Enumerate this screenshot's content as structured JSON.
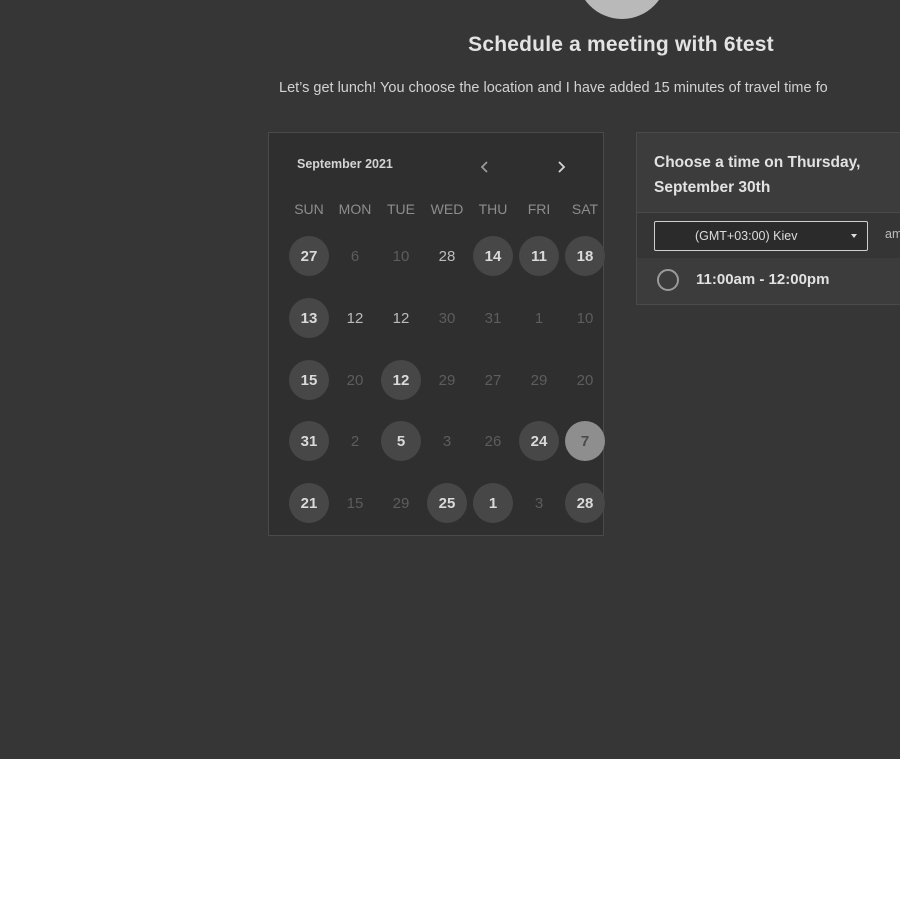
{
  "header": {
    "title": "Schedule a meeting with 6test",
    "subtitle": "Let’s get lunch! You choose the location and I have added 15 minutes of travel time fo"
  },
  "calendar": {
    "month_label": "September 2021",
    "prev_icon": "chevron-left-icon",
    "next_icon": "chevron-right-icon",
    "weekdays": [
      "SUN",
      "MON",
      "TUE",
      "WED",
      "THU",
      "FRI",
      "SAT"
    ],
    "weeks": [
      [
        "27",
        "6",
        "10",
        "28",
        "14",
        "11",
        "18"
      ],
      [
        "13",
        "12",
        "12",
        "30",
        "31",
        "1",
        "10"
      ],
      [
        "15",
        "20",
        "12",
        "29",
        "27",
        "29",
        "20"
      ],
      [
        "31",
        "2",
        "5",
        "3",
        "26",
        "24",
        "7"
      ],
      [
        "21",
        "15",
        "29",
        "25",
        "1",
        "3",
        "28"
      ]
    ],
    "states": [
      [
        "avail",
        "dim",
        "dim",
        "plain",
        "avail",
        "avail",
        "avail"
      ],
      [
        "avail",
        "plain",
        "plain",
        "dim",
        "dim",
        "dim",
        "dim"
      ],
      [
        "avail",
        "dim",
        "avail",
        "dim",
        "dim",
        "dim",
        "dim"
      ],
      [
        "avail",
        "dim",
        "avail",
        "dim",
        "dim",
        "avail",
        "selected"
      ],
      [
        "avail",
        "dim",
        "dim",
        "avail",
        "avail",
        "dim",
        "avail"
      ]
    ]
  },
  "time_panel": {
    "heading": "Choose a time on Thursday, September 30th",
    "timezone_value": "(GMT+03:00) Kiev",
    "ampm_label": "am",
    "slots": [
      {
        "label": "11:00am - 12:00pm"
      }
    ]
  },
  "colors": {
    "background": "#363636",
    "available_day": "#474747",
    "selected_day": "#8e8e8e"
  }
}
